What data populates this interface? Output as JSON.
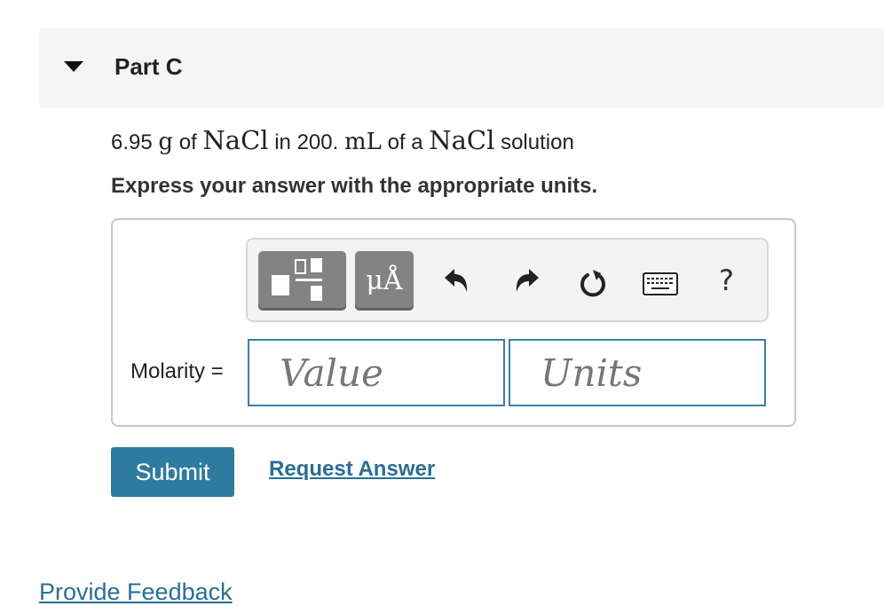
{
  "part": {
    "title": "Part C"
  },
  "problem": {
    "mass": "6.95",
    "mass_unit": "g",
    "of1": "of",
    "compound1": "NaCl",
    "in": "in",
    "volume": "200.",
    "volume_unit": "mL",
    "of2": "of a",
    "compound2": "NaCl",
    "solution": "solution"
  },
  "instruction": "Express your answer with the appropriate units.",
  "toolbar": {
    "units_label": "μÅ",
    "help_label": "?",
    "icons": [
      "templates-icon",
      "units-icon",
      "undo-icon",
      "redo-icon",
      "reset-icon",
      "keyboard-icon",
      "help-icon"
    ]
  },
  "answer": {
    "label": "Molarity =",
    "value_placeholder": "Value",
    "units_placeholder": "Units"
  },
  "actions": {
    "submit_label": "Submit",
    "request_label": "Request Answer"
  },
  "footer": {
    "feedback_label": "Provide Feedback"
  },
  "colors": {
    "accent": "#2f7b9f",
    "link": "#2a6e93",
    "toolbar_button": "#838383"
  }
}
